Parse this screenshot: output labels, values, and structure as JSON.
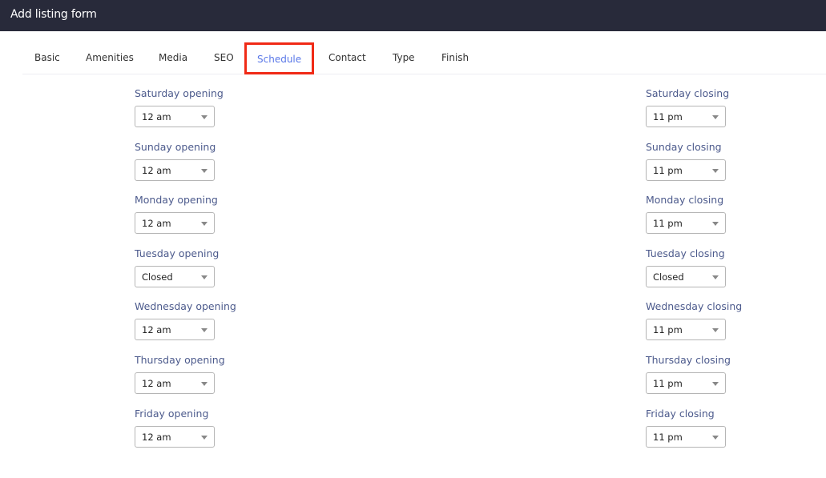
{
  "window": {
    "title": "Add listing form"
  },
  "tabs": [
    {
      "label": "Basic",
      "active": false
    },
    {
      "label": "Amenities",
      "active": false
    },
    {
      "label": "Media",
      "active": false
    },
    {
      "label": "SEO",
      "active": false
    },
    {
      "label": "Schedule",
      "active": true
    },
    {
      "label": "Contact",
      "active": false
    },
    {
      "label": "Type",
      "active": false
    },
    {
      "label": "Finish",
      "active": false
    }
  ],
  "schedule": [
    {
      "day": "Saturday",
      "opening_label": "Saturday opening",
      "opening_value": "12 am",
      "closing_label": "Saturday closing",
      "closing_value": "11 pm"
    },
    {
      "day": "Sunday",
      "opening_label": "Sunday opening",
      "opening_value": "12 am",
      "closing_label": "Sunday closing",
      "closing_value": "11 pm"
    },
    {
      "day": "Monday",
      "opening_label": "Monday opening",
      "opening_value": "12 am",
      "closing_label": "Monday closing",
      "closing_value": "11 pm"
    },
    {
      "day": "Tuesday",
      "opening_label": "Tuesday opening",
      "opening_value": "Closed",
      "closing_label": "Tuesday closing",
      "closing_value": "Closed"
    },
    {
      "day": "Wednesday",
      "opening_label": "Wednesday opening",
      "opening_value": "12 am",
      "closing_label": "Wednesday closing",
      "closing_value": "11 pm"
    },
    {
      "day": "Thursday",
      "opening_label": "Thursday opening",
      "opening_value": "12 am",
      "closing_label": "Thursday closing",
      "closing_value": "11 pm"
    },
    {
      "day": "Friday",
      "opening_label": "Friday opening",
      "opening_value": "12 am",
      "closing_label": "Friday closing",
      "closing_value": "11 pm"
    }
  ],
  "colors": {
    "titlebar": "#282a3a",
    "active_tab_text": "#5a78e8",
    "active_tab_highlight": "#f02a16",
    "field_label": "#4c5a8c"
  }
}
